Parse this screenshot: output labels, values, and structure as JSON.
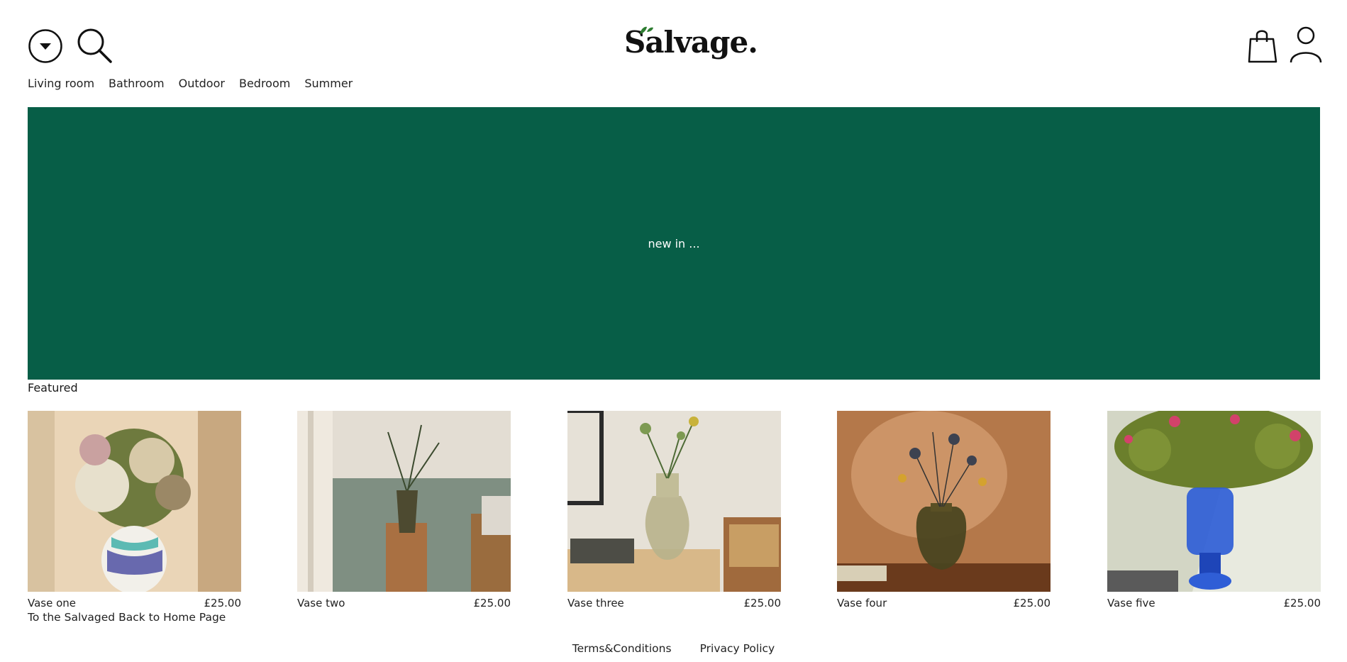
{
  "header": {
    "logo_text": "Salvage.",
    "menu_icon": "chevron-down-circle-icon",
    "search_icon": "search-icon",
    "bag_icon": "shopping-bag-icon",
    "account_icon": "user-icon"
  },
  "nav": {
    "items": [
      {
        "label": "Living room"
      },
      {
        "label": "Bathroom"
      },
      {
        "label": "Outdoor"
      },
      {
        "label": "Bedroom"
      },
      {
        "label": "Summer"
      }
    ]
  },
  "hero": {
    "text": "new in ...",
    "background": "#075e47"
  },
  "featured": {
    "title": "Featured",
    "products": [
      {
        "name": "Vase one",
        "price": "£25.00"
      },
      {
        "name": "Vase two",
        "price": "£25.00"
      },
      {
        "name": "Vase three",
        "price": "£25.00"
      },
      {
        "name": "Vase four",
        "price": "£25.00"
      },
      {
        "name": "Vase five",
        "price": "£25.00"
      }
    ]
  },
  "home_link": "To the Salvaged Back to Home Page",
  "footer": {
    "terms": "Terms&Conditions",
    "privacy": "Privacy Policy"
  }
}
